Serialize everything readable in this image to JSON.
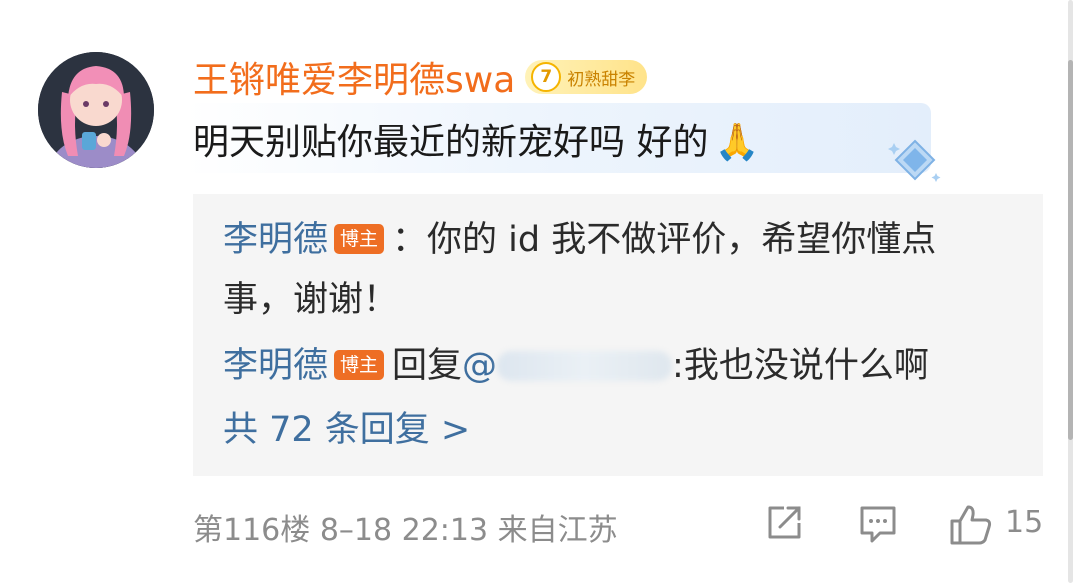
{
  "comment": {
    "username": "王锵唯爱李明德swa",
    "level": "7",
    "level_title": "初熟甜李",
    "text": "明天别贴你最近的新宠好吗 好的",
    "emoji": "🙏"
  },
  "replies": [
    {
      "author": "李明德",
      "badge": "博主",
      "separator": "：",
      "text_line1": "你的 id 我不做评价，希望你懂点",
      "text_line2": "事，谢谢！"
    },
    {
      "author": "李明德",
      "badge": "博主",
      "reply_prefix": "回复",
      "mention": "@",
      "text": ":我也没说什么啊"
    }
  ],
  "all_replies_label": "共 72 条回复 >",
  "meta": {
    "floor": "第116楼",
    "date": "8–18",
    "time": "22:13",
    "location": "来自江苏"
  },
  "actions": {
    "share_icon": "share-icon",
    "comment_icon": "comment-icon",
    "like_icon": "thumbs-up-icon",
    "like_count": "15"
  },
  "colors": {
    "username": "#f26d1c",
    "link": "#3f6f9f",
    "host_badge": "#ee6e24",
    "meta": "#8c8c8c"
  }
}
